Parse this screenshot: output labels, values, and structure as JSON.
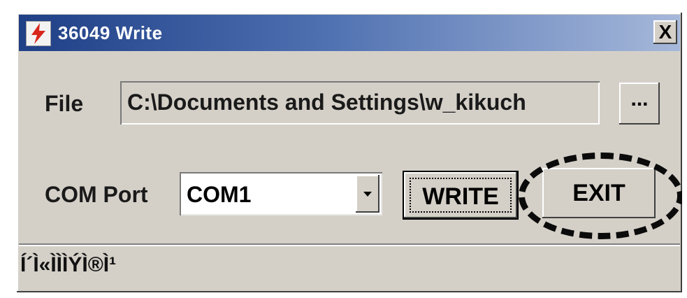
{
  "window": {
    "title": "36049 Write",
    "app_icon": "red-lightning-icon",
    "close_icon": "close-icon",
    "close_label": "X"
  },
  "file": {
    "label": "File",
    "value": "C:\\Documents and Settings\\w_kikuch",
    "browse_label": "..."
  },
  "com_port": {
    "label": "COM Port",
    "selected": "COM1",
    "dropdown_icon": "chevron-down-icon"
  },
  "buttons": {
    "write_label": "WRITE",
    "exit_label": "EXIT"
  },
  "status": {
    "text": "Í´Ì«ÌÌÌÝÌ®Ì¹"
  },
  "colors": {
    "window_bg": "#d4d0c8",
    "titlebar_start": "#1f3f86",
    "titlebar_end": "#a6b8da",
    "callout": "#0b0b0b"
  }
}
